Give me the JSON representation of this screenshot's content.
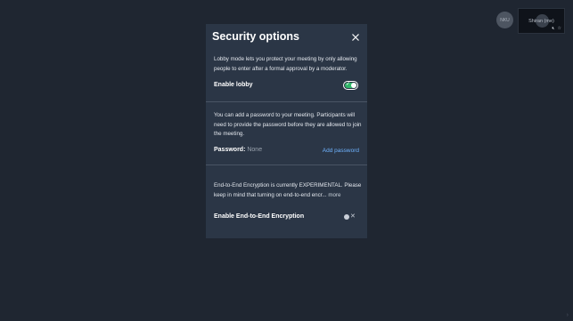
{
  "participants": {
    "remote_initials": "NKU",
    "local_name": "Shiran (me)"
  },
  "dialog": {
    "title": "Security options",
    "lobby": {
      "description": "Lobby mode lets you protect your meeting by only allowing people to enter after a formal approval by a moderator.",
      "label": "Enable lobby",
      "enabled": true
    },
    "password": {
      "description": "You can add a password to your meeting. Participants will need to provide the password before they are allowed to join the meeting.",
      "label": "Password:",
      "value": "None",
      "action": "Add password"
    },
    "e2ee": {
      "description": "End-to-End Encryption is currently EXPERIMENTAL. Please keep in mind that turning on end-to-end encr...",
      "more": "more",
      "label": "Enable End-to-End Encryption",
      "enabled": false
    }
  },
  "colors": {
    "background": "#1f2631",
    "dialog": "#2b3646",
    "toggle_on": "#31b76a",
    "link": "#6fb3ff"
  },
  "icons": [
    "close-icon",
    "check-icon",
    "x-icon",
    "mic-muted-icon",
    "star-icon"
  ]
}
